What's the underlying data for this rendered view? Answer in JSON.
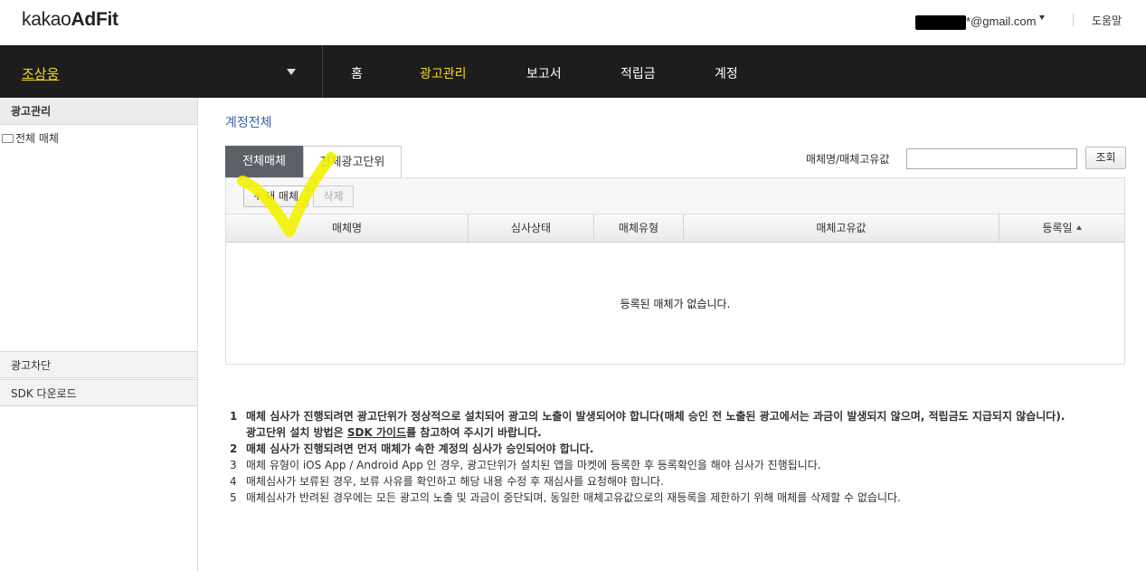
{
  "topbar": {
    "logo_prefix": "kakao",
    "logo_suffix": "AdFit",
    "account_email": "*@gmail.com",
    "help_label": "도움말"
  },
  "navbar": {
    "brand": "조상웅",
    "items": [
      {
        "label": "홈"
      },
      {
        "label": "광고관리"
      },
      {
        "label": "보고서"
      },
      {
        "label": "적립금"
      },
      {
        "label": "계정"
      }
    ],
    "active_color": "#f7dc1c"
  },
  "sidebar": {
    "section_ad_manage": "광고관리",
    "tree_all_media": "전체 매체",
    "section_ad_block": "광고차단",
    "section_sdk": "SDK 다운로드"
  },
  "main": {
    "title": "계정전체",
    "tabs": [
      {
        "label": "전체매체"
      },
      {
        "label": "전체광고단위"
      }
    ],
    "search_label": "매체명/매체고유값",
    "search_value": "",
    "search_button": "조회",
    "new_media_button": "새 매체",
    "delete_button": "삭제",
    "columns": [
      "매체명",
      "심사상태",
      "매체유형",
      "매체고유값",
      "등록일"
    ],
    "empty_message": "등록된 매체가 없습니다."
  },
  "notes": {
    "n1_num": "1",
    "n1_text": "매체 심사가 진행되려면 광고단위가 정상적으로 설치되어 광고의 노출이 발생되어야 합니다(매체 승인 전 노출된 광고에서는 과금이 발생되지 않으며, 적립금도 지급되지 않습니다).",
    "n1_sub_before": "광고단위 설치 방법은 ",
    "n1_sub_link": "SDK 가이드",
    "n1_sub_after": "를 참고하여 주시기 바랍니다.",
    "n2_num": "2",
    "n2_text": "매체 심사가 진행되려면 먼저 매체가 속한 계정의 심사가 승인되어야 합니다.",
    "n3_num": "3",
    "n3_text": "매체 유형이 iOS App / Android App 인 경우, 광고단위가 설치된 앱을 마켓에 등록한 후 등록확인을 해야 심사가 진행됩니다.",
    "n4_num": "4",
    "n4_text": "매체심사가 보류된 경우, 보류 사유를 확인하고 해당 내용 수정 후 재심사를 요청해야 합니다.",
    "n5_num": "5",
    "n5_text": "매체심사가 반려된 경우에는 모든 광고의 노출 및 과금이 중단되며, 동일한 매체고유값으로의 재등록을 제한하기 위해 매체를 삭제할 수 없습니다."
  }
}
